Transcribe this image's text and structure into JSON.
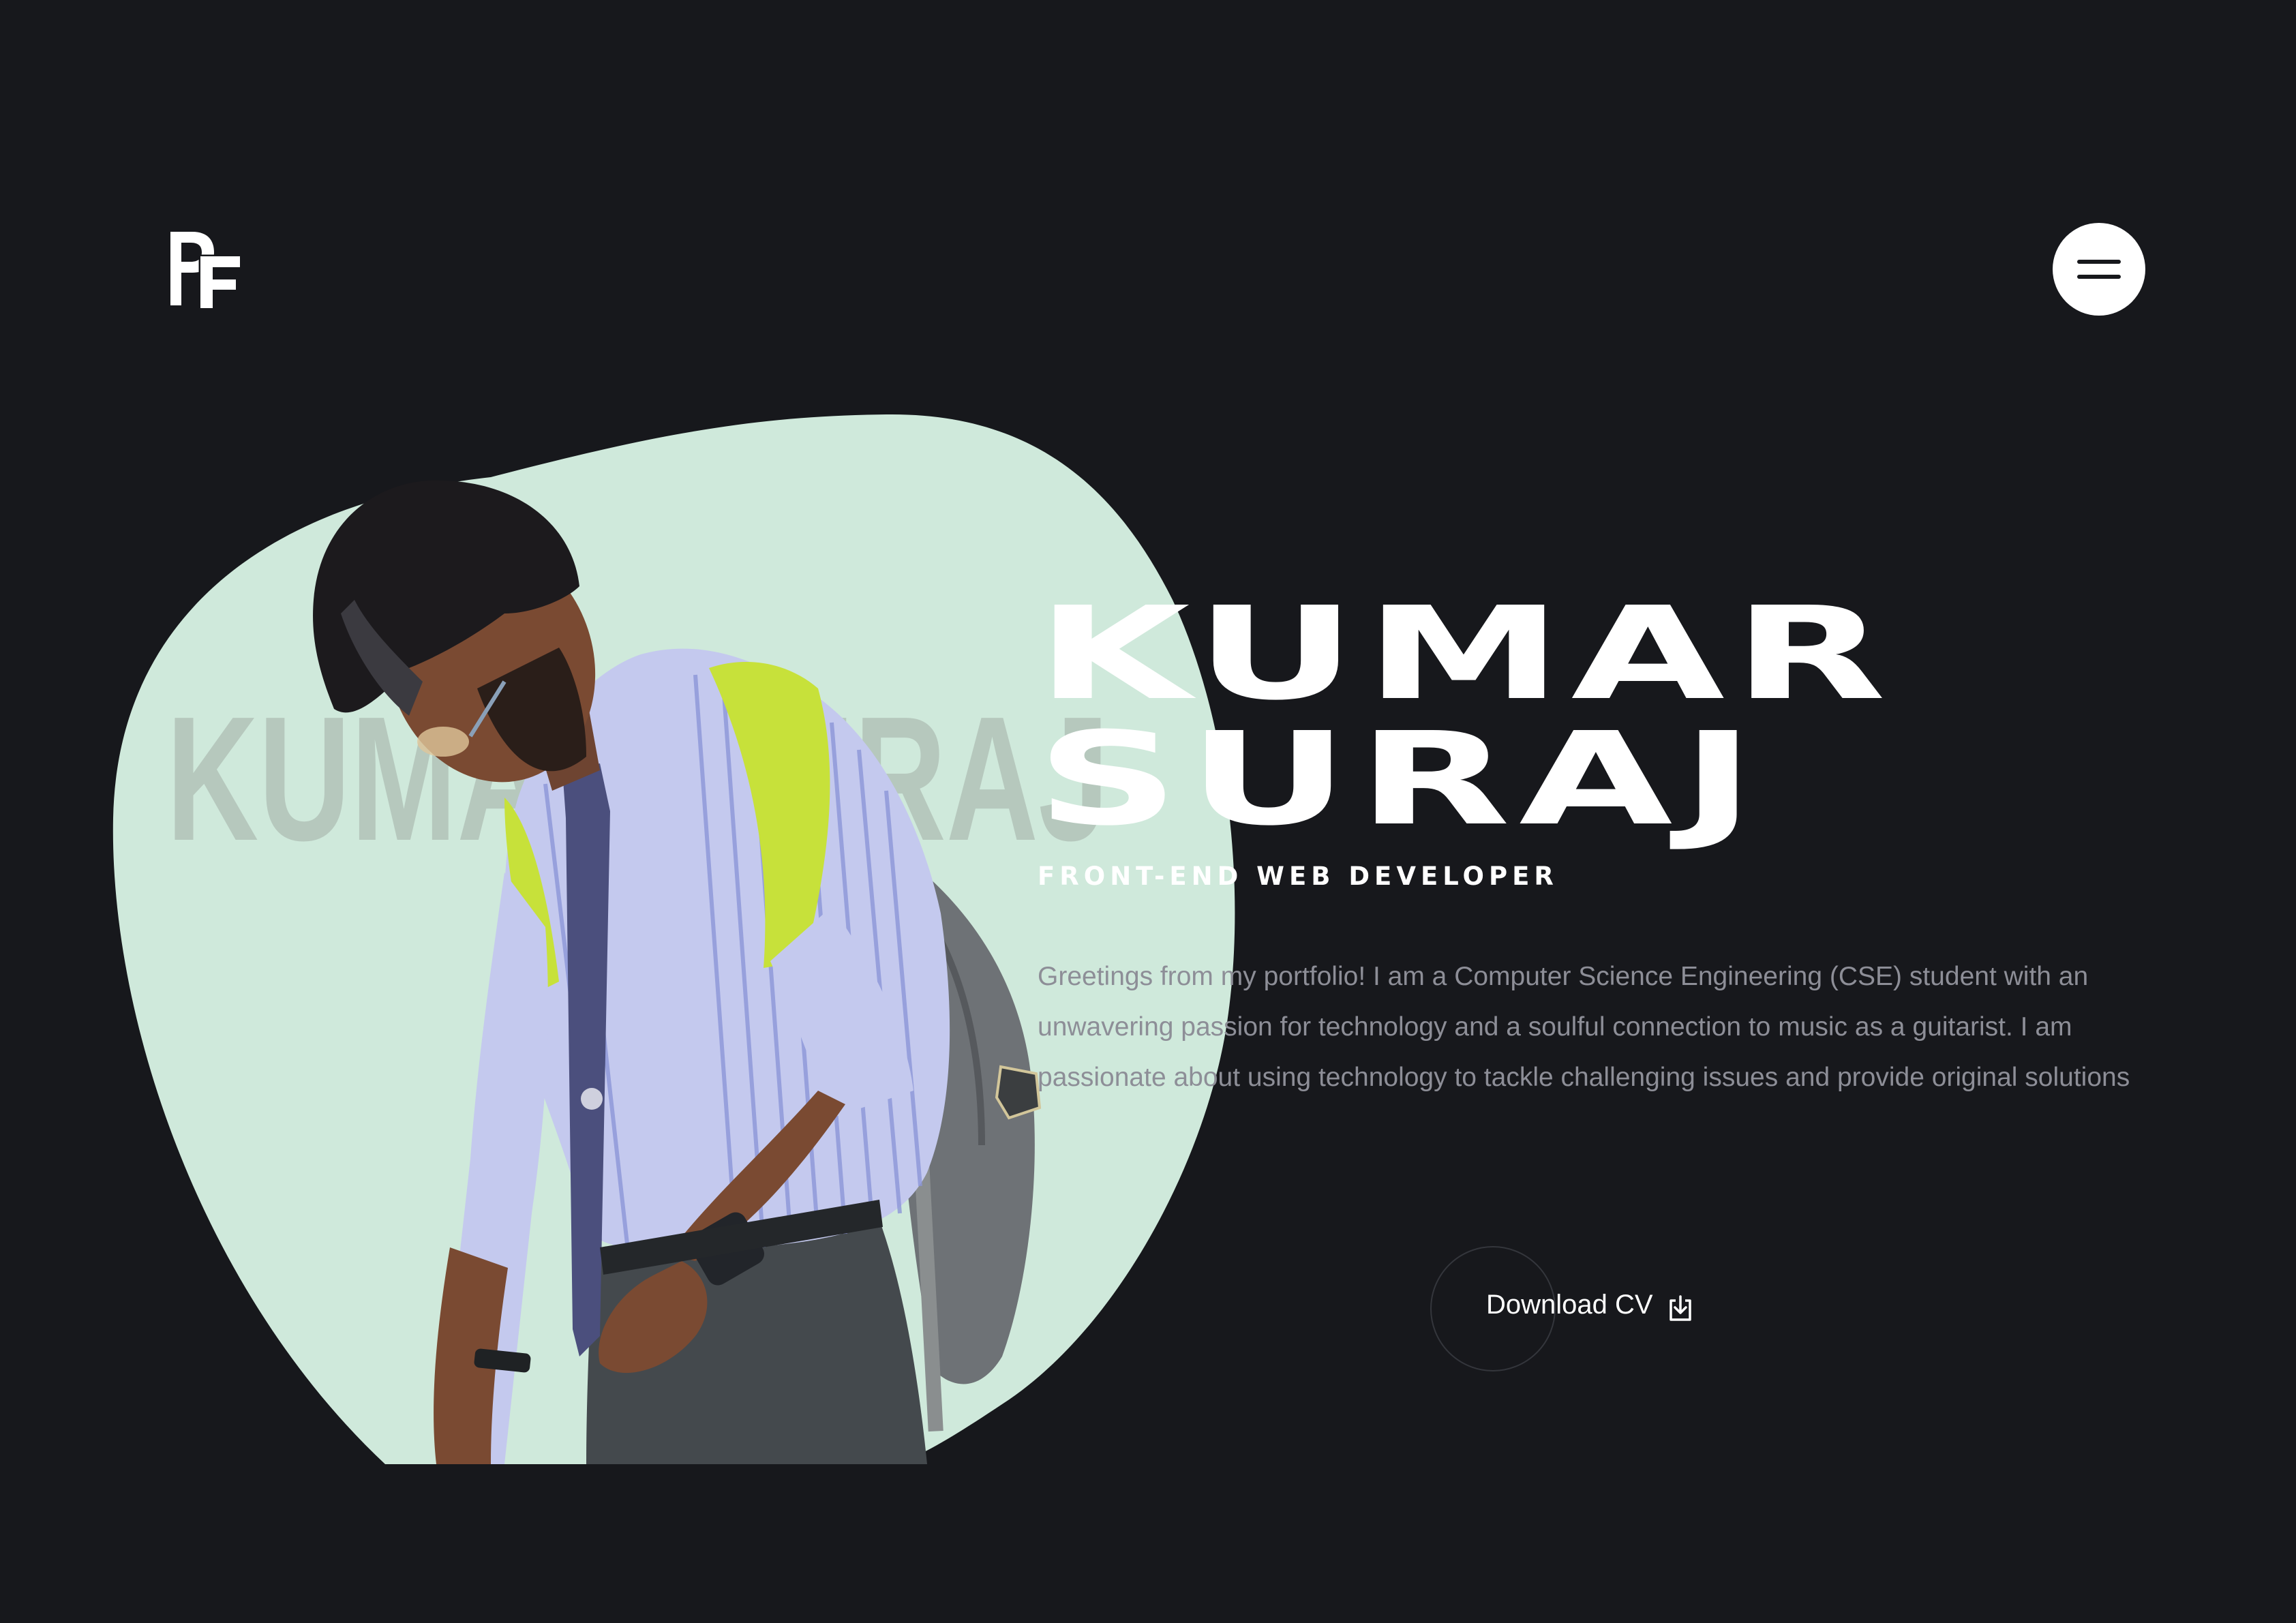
{
  "header": {
    "logo_text": "PF",
    "menu_icon": "hamburger-icon"
  },
  "hero": {
    "name_line1": "KUMAR",
    "name_line2": "SURAJ",
    "watermark_text": "KUMAR SURAJ",
    "role": "FRONT-END WEB DEVELOPER",
    "bio": "Greetings from my portfolio! I am a Computer Science Engineering (CSE) student with an unwavering passion for technology and a soulful connection to music as a guitarist. I am passionate about using technology to tackle challenging issues and provide original solutions",
    "cta_label": "Download CV",
    "cta_icon": "download-icon"
  },
  "colors": {
    "background": "#17181c",
    "blob": "#cfe9db",
    "text_muted": "#8d8e97",
    "text_primary": "#ffffff"
  }
}
